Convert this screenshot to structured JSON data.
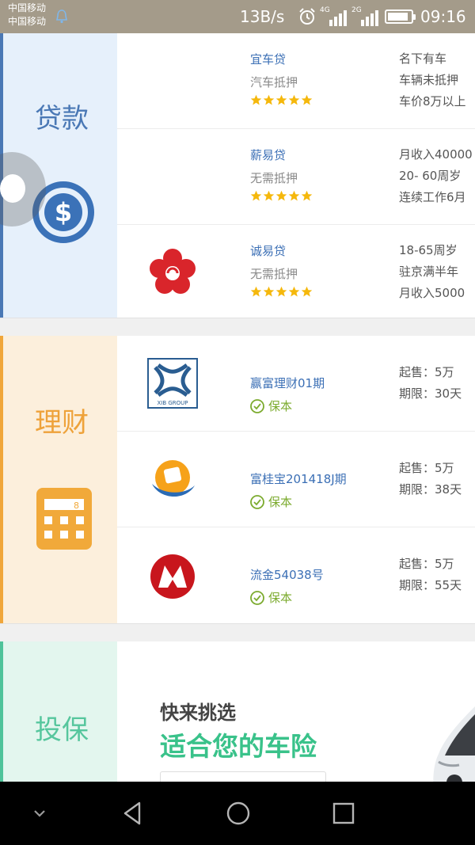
{
  "status_bar": {
    "carrier_1": "中国移动",
    "carrier_2": "中国移动",
    "net_speed": "13B/s",
    "signal_1_tag": "4G",
    "signal_2_tag": "2G",
    "battery_level": 0.9,
    "time": "09:16"
  },
  "loan": {
    "label": "贷款",
    "icon": "dollar-icon",
    "accent": "#4a78b5",
    "bg": "#e6f0fb",
    "items": [
      {
        "name": "宜车贷",
        "collateral": "汽车抵押",
        "rating": 5,
        "logo": "",
        "reqs": [
          "名下有车",
          "车辆未抵押",
          "车价8万以上"
        ]
      },
      {
        "name": "薪易贷",
        "collateral": "无需抵押",
        "rating": 5,
        "logo": "",
        "reqs": [
          "月收入40000",
          "20- 60周岁",
          "连续工作6月"
        ]
      },
      {
        "name": "诚易贷",
        "collateral": "无需抵押",
        "rating": 5,
        "logo": "red-flower-logo",
        "reqs": [
          "18-65周岁",
          "驻京满半年",
          "月收入5000"
        ]
      }
    ]
  },
  "finance": {
    "label": "理财",
    "icon": "calculator-icon",
    "accent": "#f0a63a",
    "bg": "#fcefdc",
    "guarantee_label": "保本",
    "items": [
      {
        "name": "赢富理财01期",
        "logo": "xib-group-logo",
        "logo_text": "XIB GROUP",
        "min": "起售：5万",
        "term": "期限：30天"
      },
      {
        "name": "富桂宝201418J期",
        "logo": "orange-bank-logo",
        "min": "起售：5万",
        "term": "期限：38天"
      },
      {
        "name": "流金54038号",
        "logo": "cmb-logo",
        "min": "起售：5万",
        "term": "期限：55天"
      }
    ]
  },
  "insurance": {
    "label": "投保",
    "accent": "#4fc39a",
    "bg": "#e3f6ee",
    "title_1": "快来挑选",
    "title_2": "适合您的车险"
  },
  "colors": {
    "star": "#f5b80c",
    "link": "#3b6fb5",
    "guarantee": "#7cab2f"
  }
}
